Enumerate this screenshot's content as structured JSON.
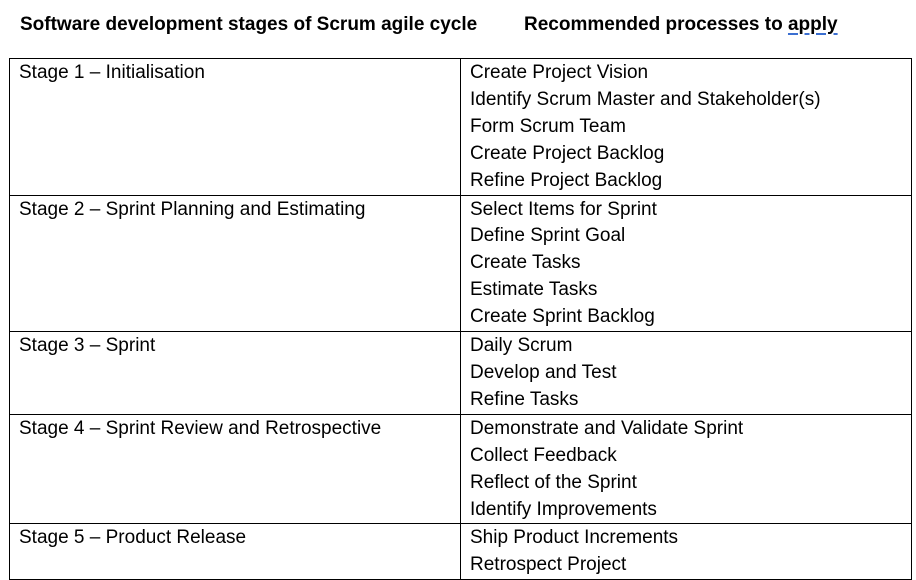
{
  "header": {
    "left": "Software development stages of Scrum agile cycle",
    "right_prefix": "Recommended processes to ",
    "right_underlined": "apply"
  },
  "rows": [
    {
      "stage": "Stage 1 – Initialisation",
      "processes": [
        "Create Project Vision",
        "Identify Scrum Master and Stakeholder(s)",
        "Form Scrum Team",
        "Create Project Backlog",
        "Refine Project Backlog"
      ]
    },
    {
      "stage": "Stage 2 – Sprint Planning and Estimating",
      "processes": [
        "Select Items for Sprint",
        "Define Sprint Goal",
        "Create Tasks",
        "Estimate Tasks",
        "Create Sprint Backlog"
      ]
    },
    {
      "stage": "Stage 3 – Sprint",
      "processes": [
        "Daily Scrum",
        "Develop and Test",
        "Refine Tasks"
      ]
    },
    {
      "stage": "Stage 4 – Sprint Review and Retrospective",
      "processes": [
        "Demonstrate and Validate Sprint",
        "Collect Feedback",
        "Reflect of the Sprint",
        "Identify Improvements"
      ]
    },
    {
      "stage": "Stage 5 – Product Release",
      "processes": [
        "Ship Product Increments",
        "Retrospect Project"
      ]
    }
  ]
}
